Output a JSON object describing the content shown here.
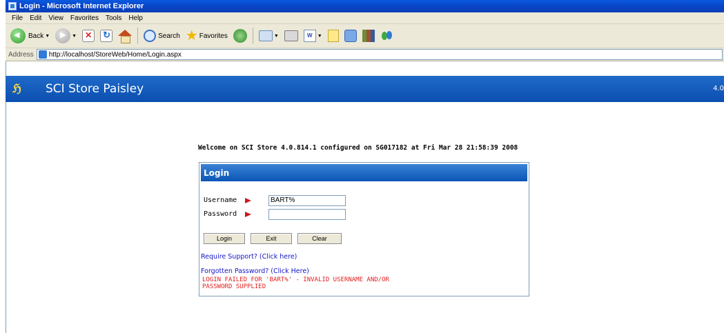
{
  "window": {
    "title": "Login - Microsoft Internet Explorer"
  },
  "menu": [
    "File",
    "Edit",
    "View",
    "Favorites",
    "Tools",
    "Help"
  ],
  "toolbar": {
    "back_label": "Back",
    "search_label": "Search",
    "favorites_label": "Favorites"
  },
  "address": {
    "label": "Address",
    "url": "http://localhost/StoreWeb/Home/Login.aspx"
  },
  "app": {
    "logo_text": "ℌ",
    "title": "SCI Store Paisley",
    "version": "4.0"
  },
  "welcome": "Welcome on SCI Store 4.0.814.1 configured on SG017182 at Fri Mar 28 21:58:39 2008",
  "login": {
    "header": "Login",
    "username_label": "Username",
    "username_value": "BART%",
    "password_label": "Password",
    "password_value": "",
    "login_button": "Login",
    "exit_button": "Exit",
    "clear_button": "Clear",
    "support_link": "Require Support? (Click here)",
    "forgot_link": "Forgotten Password? (Click Here)",
    "error_message": "LOGIN FAILED FOR 'BART%' - INVALID USERNAME AND/OR PASSWORD SUPPLIED"
  }
}
